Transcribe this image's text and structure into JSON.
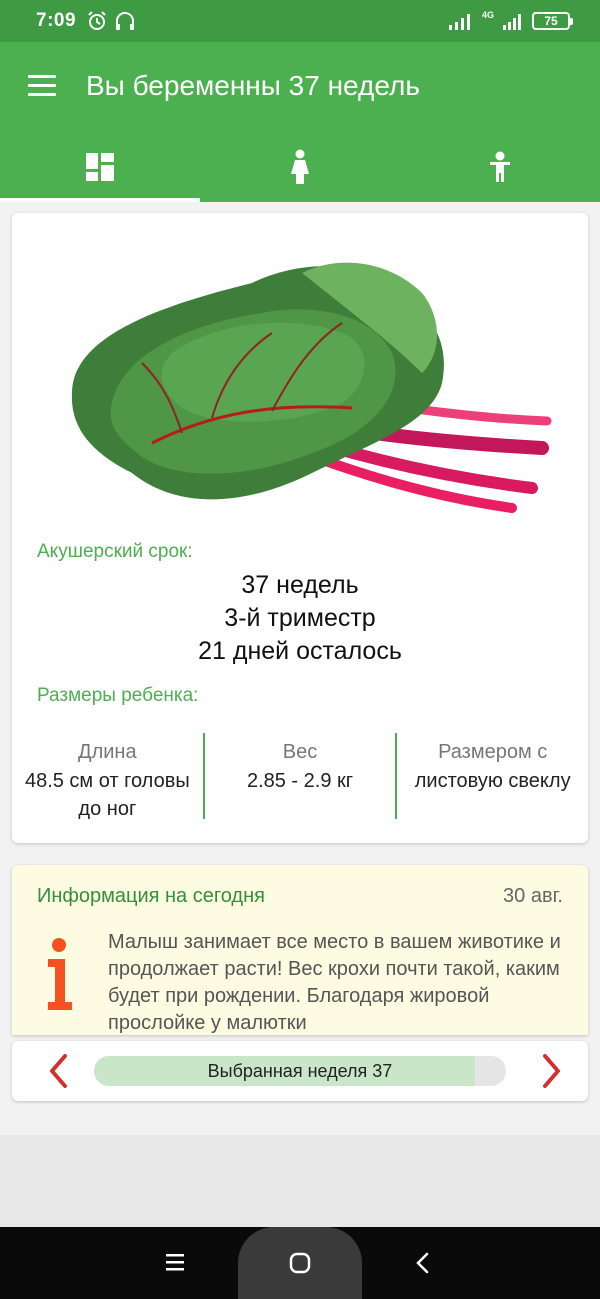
{
  "status_bar": {
    "time": "7:09",
    "battery": "75",
    "network": "4G"
  },
  "app_bar": {
    "title": "Вы беременны 37 недель"
  },
  "tabs": [
    {
      "icon": "dashboard-icon",
      "active": true
    },
    {
      "icon": "mother-icon",
      "active": false
    },
    {
      "icon": "baby-icon",
      "active": false
    }
  ],
  "week_card": {
    "illustration": "swiss-chard-image",
    "term_label": "Акушерский срок:",
    "term_lines": [
      "37 недель",
      "3-й триместр",
      "21 дней осталось"
    ],
    "sizes_label": "Размеры ребенка:",
    "sizes": [
      {
        "title": "Длина",
        "value": "48.5 см от головы до ног"
      },
      {
        "title": "Вес",
        "value": "2.85 - 2.9 кг"
      },
      {
        "title": "Размером с",
        "value": "листовую свеклу"
      }
    ]
  },
  "info_card": {
    "title": "Информация на сегодня",
    "date": "30 авг.",
    "text": "Малыш занимает все место в вашем животике и продолжает расти! Вес крохи почти такой, каким будет при рождении. Благодаря жировой прослойке у малютки"
  },
  "week_nav": {
    "label": "Выбранная неделя 37",
    "progress_fraction": 0.925
  },
  "colors": {
    "primary": "#4cb050",
    "status_bar": "#3e9b43",
    "accent_red": "#d32f2f",
    "info_bg": "#fdfbe2"
  }
}
